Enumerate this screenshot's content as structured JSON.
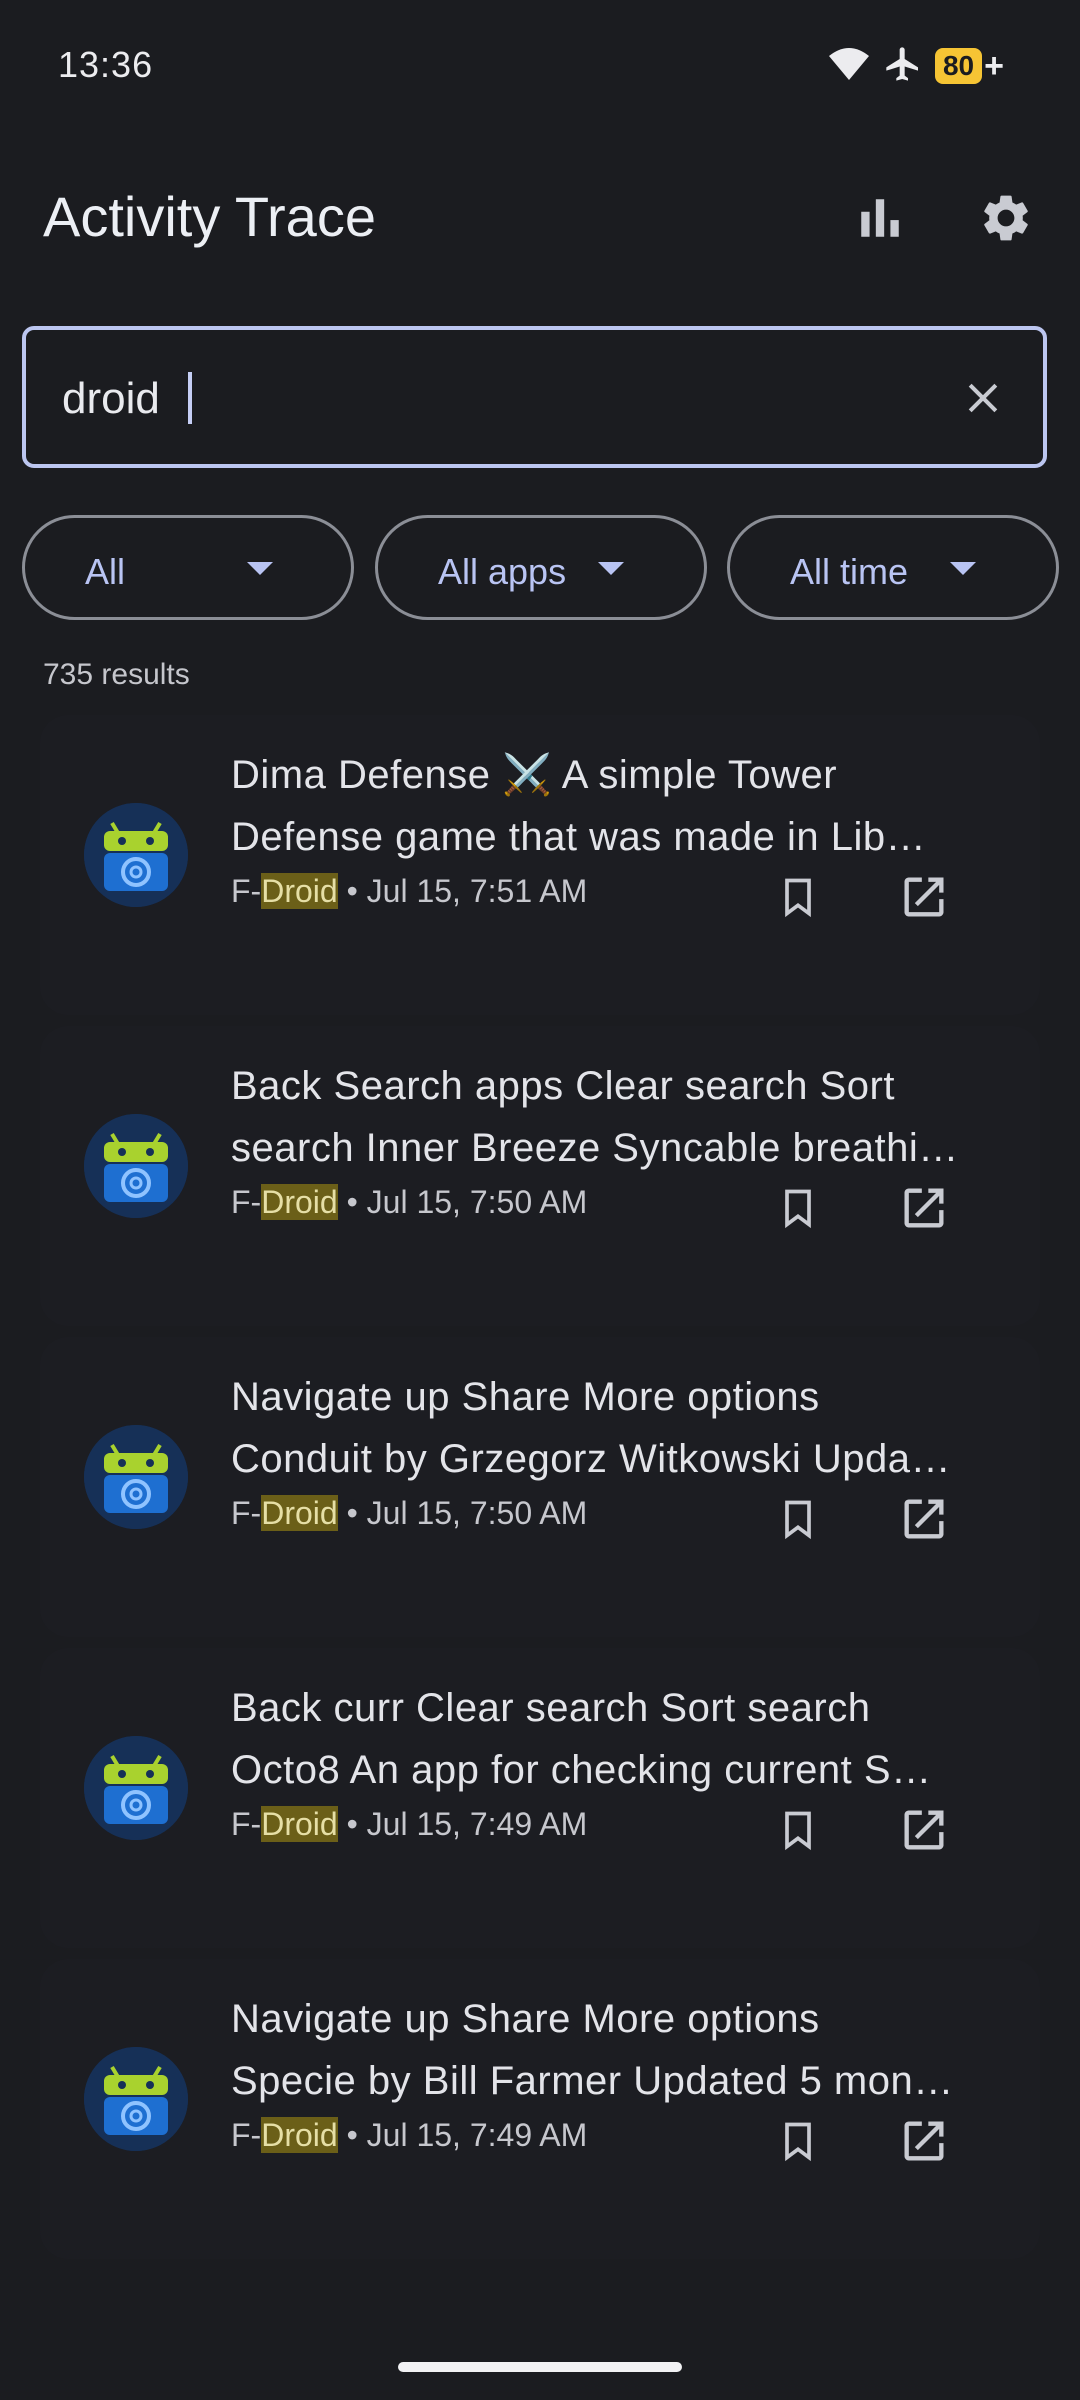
{
  "status_bar": {
    "time": "13:36",
    "battery_level": "80",
    "battery_charging": "+",
    "icons": [
      "wifi-icon",
      "airplane-icon",
      "battery-icon"
    ]
  },
  "app_bar": {
    "title": "Activity Trace",
    "actions": [
      "bar-chart-icon",
      "settings-gear-icon"
    ]
  },
  "search": {
    "value": "droid",
    "clear_icon": "close-icon"
  },
  "filters": [
    {
      "label": "All"
    },
    {
      "label": "All apps"
    },
    {
      "label": "All time"
    }
  ],
  "results_count": "735 results",
  "results": [
    {
      "line1": " Dima Defense ⚔️ A simple Tower",
      "line2": "Defense game that was made in Lib…",
      "source_prefix": "F-",
      "source_match": "Droid",
      "time": " • Jul 15, 7:51 AM"
    },
    {
      "line1": "Back Search apps Clear search Sort",
      "line2": "search Inner Breeze Syncable breathi…",
      "source_prefix": "F-",
      "source_match": "Droid",
      "time": " • Jul 15, 7:50 AM"
    },
    {
      "line1": "Navigate up Share More options",
      "line2": "Conduit by Grzegorz Witkowski Upda…",
      "source_prefix": "F-",
      "source_match": "Droid",
      "time": " • Jul 15, 7:50 AM"
    },
    {
      "line1": "Back curr Clear search Sort search",
      "line2": "Octo8 An app for checking current S…",
      "source_prefix": "F-",
      "source_match": "Droid",
      "time": " • Jul 15, 7:49 AM"
    },
    {
      "line1": "Navigate up Share More options",
      "line2": "Specie by Bill Farmer Updated 5 mon…",
      "source_prefix": "F-",
      "source_match": "Droid",
      "time": " • Jul 15, 7:49 AM"
    }
  ],
  "colors": {
    "background": "#1b1c20",
    "accent": "#b9c4f3",
    "highlight": "#6b5f18",
    "battery": "#f6c434"
  }
}
